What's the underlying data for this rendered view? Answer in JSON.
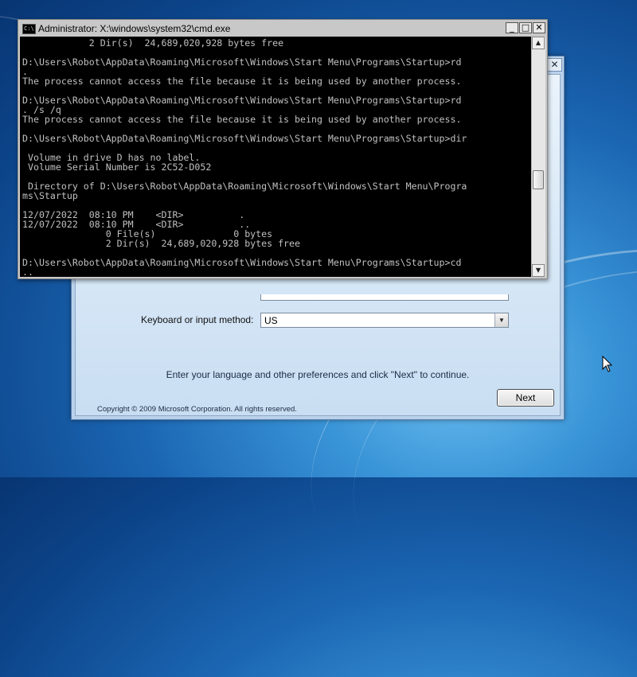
{
  "setup": {
    "close_glyph": "✕",
    "keyboard_label": "Keyboard or input method:",
    "keyboard_value": "US",
    "instruction": "Enter your language and other preferences and click \"Next\" to continue.",
    "copyright": "Copyright © 2009 Microsoft Corporation. All rights reserved.",
    "next_label": "Next"
  },
  "cmd": {
    "title": "Administrator: X:\\windows\\system32\\cmd.exe",
    "icon_text": "C:\\",
    "buttons": {
      "minimize": "_",
      "maximize": "□",
      "close": "✕"
    },
    "lines": [
      "            2 Dir(s)  24,689,020,928 bytes free",
      "",
      "D:\\Users\\Robot\\AppData\\Roaming\\Microsoft\\Windows\\Start Menu\\Programs\\Startup>rd",
      ".",
      "The process cannot access the file because it is being used by another process.",
      "",
      "D:\\Users\\Robot\\AppData\\Roaming\\Microsoft\\Windows\\Start Menu\\Programs\\Startup>rd",
      ". /s /q",
      "The process cannot access the file because it is being used by another process.",
      "",
      "D:\\Users\\Robot\\AppData\\Roaming\\Microsoft\\Windows\\Start Menu\\Programs\\Startup>dir",
      "",
      " Volume in drive D has no label.",
      " Volume Serial Number is 2C52-D052",
      "",
      " Directory of D:\\Users\\Robot\\AppData\\Roaming\\Microsoft\\Windows\\Start Menu\\Progra",
      "ms\\Startup",
      "",
      "12/07/2022  08:10 PM    <DIR>          .",
      "12/07/2022  08:10 PM    <DIR>          ..",
      "               0 File(s)              0 bytes",
      "               2 Dir(s)  24,689,020,928 bytes free",
      "",
      "D:\\Users\\Robot\\AppData\\Roaming\\Microsoft\\Windows\\Start Menu\\Programs\\Startup>cd",
      ".."
    ]
  },
  "colors": {
    "console_bg": "#000000",
    "console_text": "#c0c0c0",
    "desktop_blue": "#1b66b3"
  },
  "icons": {
    "scroll_up": "arrow-up-icon",
    "scroll_down": "arrow-down-icon",
    "dropdown": "chevron-down-icon",
    "cursor": "mouse-pointer-icon"
  }
}
